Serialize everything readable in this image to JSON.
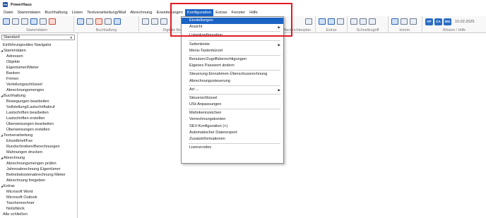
{
  "app": {
    "title": "PowerHaus",
    "logo": "PH"
  },
  "menubar": [
    "Datei",
    "Stammdaten",
    "Buchhaltung",
    "Listen",
    "Textverarbeitung/Mail",
    "Abrechnung",
    "Erweiterungen",
    "Konfiguration",
    "Extras",
    "Fenster",
    "Hilfe"
  ],
  "active_menu": "Konfiguration",
  "ribbon": {
    "groups": [
      "Stammdaten",
      "Buchhaltung",
      "Digitale Belegerfassung",
      "Nachrichtenplan",
      "Extras",
      "Schnellzugriff",
      "komm.",
      "Wissen / Hilfe"
    ],
    "pills": [
      "VP",
      "CA",
      "WG"
    ],
    "date": "10.02.2025"
  },
  "sidebar": {
    "select_value": "Standard",
    "tree": [
      {
        "label": "Einführungsvideo Navigator",
        "kind": "l0"
      },
      {
        "label": "Stammdaten",
        "kind": "cat"
      },
      {
        "label": "Adressen",
        "kind": "l1"
      },
      {
        "label": "Objekte",
        "kind": "l1"
      },
      {
        "label": "Eigentümer/Mieter",
        "kind": "l1"
      },
      {
        "label": "Banken",
        "kind": "l1"
      },
      {
        "label": "Firmen",
        "kind": "l1"
      },
      {
        "label": "Verteilungsschlüssel",
        "kind": "l1"
      },
      {
        "label": "Abrechnungsmengen",
        "kind": "l1"
      },
      {
        "label": "Buchhaltung",
        "kind": "cat"
      },
      {
        "label": "Bewegungen bearbeiten",
        "kind": "l1"
      },
      {
        "label": "Sollstellung/Lastschriftabruf",
        "kind": "l1"
      },
      {
        "label": "Lastschriften bearbeiten",
        "kind": "l1"
      },
      {
        "label": "Lastschriften erstellen",
        "kind": "l1"
      },
      {
        "label": "Überweisungen bearbeiten",
        "kind": "l1"
      },
      {
        "label": "Überweisungen erstellen",
        "kind": "l1"
      },
      {
        "label": "Textverarbeitung",
        "kind": "cat"
      },
      {
        "label": "Einzelbrief/Fax",
        "kind": "l1"
      },
      {
        "label": "Rundschreiben/Berechnungen",
        "kind": "l1"
      },
      {
        "label": "Mahnungen drucken",
        "kind": "l1"
      },
      {
        "label": "Abrechnung",
        "kind": "cat"
      },
      {
        "label": "Abrechnungsmengen prüfen",
        "kind": "l1"
      },
      {
        "label": "Jahresabrechnung Eigentümer",
        "kind": "l1"
      },
      {
        "label": "Betriebskostenabrechnung Mieter",
        "kind": "l1"
      },
      {
        "label": "Abrechnung freigeben",
        "kind": "l1"
      },
      {
        "label": "Extras",
        "kind": "cat"
      },
      {
        "label": "Microsoft Word",
        "kind": "l1"
      },
      {
        "label": "Microsoft Outlook",
        "kind": "l1"
      },
      {
        "label": "Taschenrechner",
        "kind": "l1"
      },
      {
        "label": "Notizblock",
        "kind": "l1"
      },
      {
        "label": "Alle schließen",
        "kind": "l0"
      }
    ]
  },
  "dropdown": {
    "items": [
      {
        "label": "Einstellungen",
        "highlighted": true
      },
      {
        "label": "Ansicht",
        "submenu": true
      },
      {
        "sep": true
      },
      {
        "label": "Listenkonfiguration"
      },
      {
        "sep": true
      },
      {
        "label": "Seitenleiste",
        "submenu": true
      },
      {
        "label": "Menü-Tastenkürzel"
      },
      {
        "sep": true
      },
      {
        "label": "Benutzer/Zugriffsberechtigungen"
      },
      {
        "label": "Eigenes Passwort ändern"
      },
      {
        "sep": true
      },
      {
        "label": "Steuerung Einnahmen-Überschussrechnung"
      },
      {
        "label": "Abrechnungssteuerung"
      },
      {
        "sep": true
      },
      {
        "label": "Art ...",
        "submenu": true
      },
      {
        "sep": true
      },
      {
        "label": "Steuerschlüssel"
      },
      {
        "label": "USt-Anpassungen"
      },
      {
        "sep": true
      },
      {
        "label": "Mahnkennzeichen"
      },
      {
        "label": "Verrechnungskonten"
      },
      {
        "label": "SEV-Konfiguration (+)"
      },
      {
        "label": "Automatischer Datenexport"
      },
      {
        "label": "Zusatzinformationen"
      },
      {
        "sep": true
      },
      {
        "label": "Lizenzcodes"
      }
    ]
  },
  "colors": {
    "accent": "#1a63c4",
    "highlight_box": "#e01b24"
  }
}
